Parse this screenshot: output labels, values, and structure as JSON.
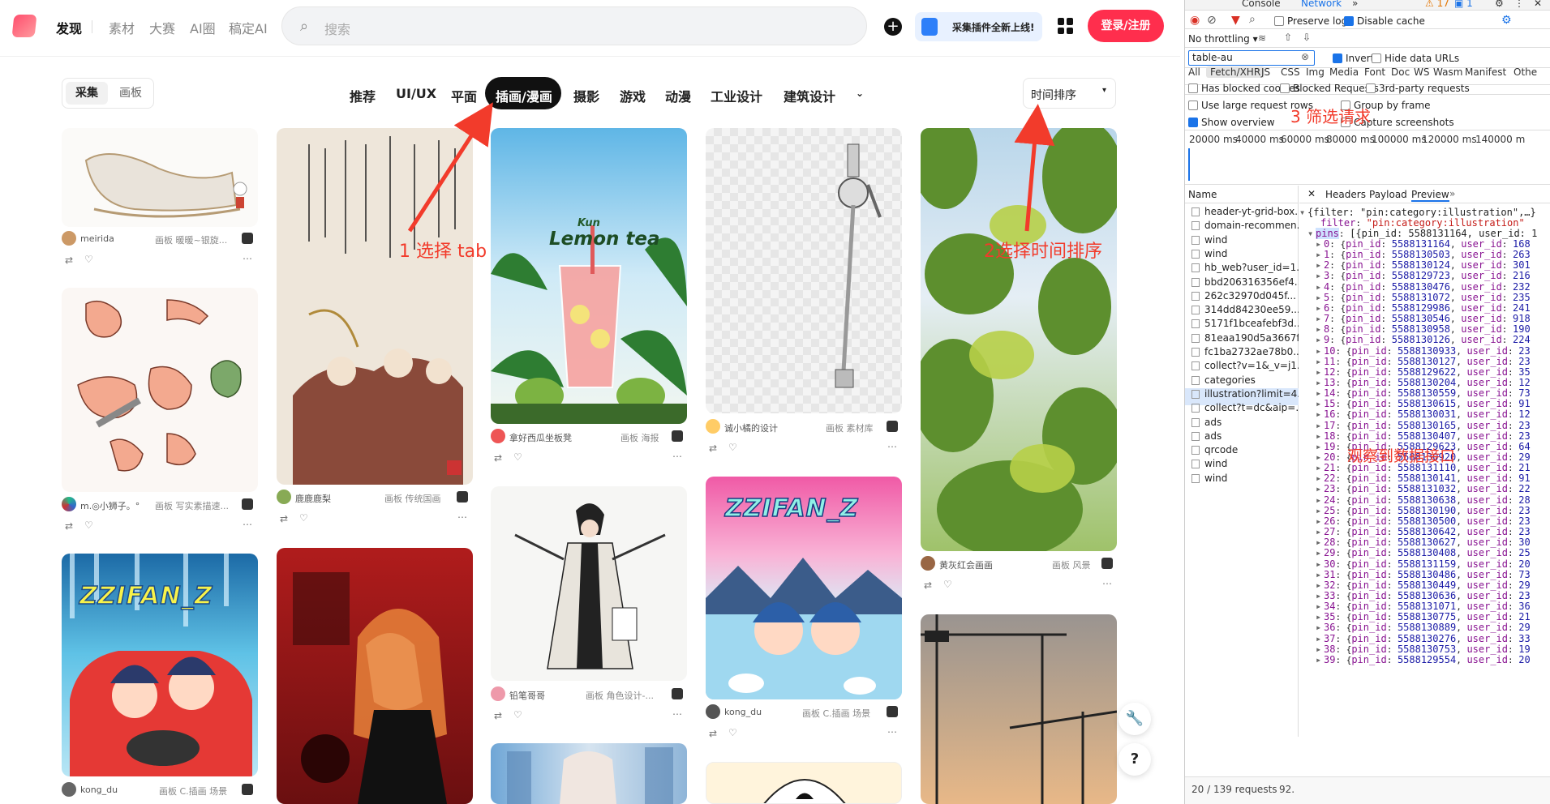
{
  "site": {
    "nav": {
      "discover": "发现",
      "material": "素材",
      "contest": "大赛",
      "ai_circle": "AI圈",
      "gaoding_ai": "稿定AI"
    },
    "search": {
      "placeholder": "搜索"
    },
    "plugin_label": "采集插件全新上线!",
    "login_label": "登录/注册",
    "mode_toggle": {
      "collect": "采集",
      "board": "画板"
    },
    "categories": [
      "推荐",
      "UI/UX",
      "平面",
      "插画/漫画",
      "摄影",
      "游戏",
      "动漫",
      "工业设计",
      "建筑设计"
    ],
    "active_category": "插画/漫画",
    "sort_label": "时间排序",
    "cards": [
      {
        "user": "meirida",
        "board": "画板 暖暖~银旋...",
        "caption_color": "#f5f0ea"
      },
      {
        "user": "m.◎小狮子。°",
        "board": "画板 写实素描速...",
        "caption_color": "#ffffff"
      },
      {
        "user": "kong_du",
        "board": "画板 C.插画 场景",
        "caption_color": "#5ab0e0"
      },
      {
        "user": "鹿鹿鹿梨",
        "board": "画板 传统国画",
        "caption_color": "#efe8dd"
      },
      {
        "user": "",
        "board": "",
        "caption_color": "#7a1a1a"
      },
      {
        "user": "拿好西瓜坐板凳",
        "board": "画板 海报",
        "caption_color": "#cde6f4"
      },
      {
        "user": "铅笔哥哥",
        "board": "画板 角色设计-...",
        "caption_color": "#f2f2f2"
      },
      {
        "user": "诚小橘的设计",
        "board": "画板 素材库",
        "caption_color": "#e8e8e8"
      },
      {
        "user": "kong_du",
        "board": "画板 C.插画 场景",
        "caption_color": "#f29ac6"
      },
      {
        "user": "黄灰红会画画",
        "board": "画板 风景",
        "caption_color": "#5ea0d8"
      }
    ],
    "card_texts": {
      "lemon_brand": "Kun",
      "lemon_title": "Lemon tea",
      "zzifan": "ZZIFAN_Z"
    },
    "annotations": {
      "a1": "1 选择 tab",
      "a2": "2选择时间排序",
      "a3": "3 筛选请求",
      "a4": "观察到数据接口"
    },
    "float_buttons": {
      "tool": "🔧",
      "help": "?"
    }
  },
  "devtools": {
    "top_tabs": {
      "console": "Console",
      "network": "Network"
    },
    "badges": {
      "warn": "17",
      "msg": "1"
    },
    "toolbar": {
      "preserve_log": "Preserve log",
      "disable_cache": "Disable cache",
      "throttle": "No throttling"
    },
    "filter": {
      "value": "table-au",
      "invert": "Invert",
      "hide_data_urls": "Hide data URLs"
    },
    "type_tabs": [
      "All",
      "Fetch/XHR",
      "JS",
      "CSS",
      "Img",
      "Media",
      "Font",
      "Doc",
      "WS",
      "Wasm",
      "Manifest",
      "Othe"
    ],
    "options": {
      "has_blocked": "Has blocked cookies",
      "blocked_requests": "Blocked Requests",
      "third_party": "3rd-party requests",
      "large_rows": "Use large request rows",
      "group_frame": "Group by frame",
      "show_overview": "Show overview",
      "capture_screens": "Capture screenshots"
    },
    "timeline": [
      "20000 ms",
      "40000 ms",
      "60000 ms",
      "80000 ms",
      "100000 ms",
      "120000 ms",
      "140000 m"
    ],
    "name_header": "Name",
    "requests": [
      "header-yt-grid-box...",
      "domain-recommen...",
      "wind",
      "wind",
      "hb_web?user_id=1...",
      "bbd206316356ef4...",
      "262c32970d045f...",
      "314dd84230ee59...",
      "5171f1bceafebf3d...",
      "81eaa190d5a3667f...",
      "fc1ba2732ae78b0...",
      "collect?v=1&_v=j1...",
      "categories",
      "illustration?limit=4...",
      "collect?t=dc&aip=...",
      "ads",
      "ads",
      "qrcode",
      "wind",
      "wind"
    ],
    "selected_request_index": 13,
    "detail_tabs": {
      "headers": "Headers",
      "payload": "Payload",
      "preview": "Preview"
    },
    "preview": {
      "root": "{filter: \"pin:category:illustration\",…}",
      "filter_key": "filter",
      "filter_val": "\"pin:category:illustration\"",
      "pins_key": "pins",
      "pins_summary": "[{pin_id: 5588131164, user_id: 1",
      "items": [
        [
          "0",
          "5588131164",
          "168"
        ],
        [
          "1",
          "5588130503",
          "263"
        ],
        [
          "2",
          "5588130124",
          "301"
        ],
        [
          "3",
          "5588129723",
          "216"
        ],
        [
          "4",
          "5588130476",
          "232"
        ],
        [
          "5",
          "5588131072",
          "235"
        ],
        [
          "6",
          "5588129986",
          "241"
        ],
        [
          "7",
          "5588130546",
          "918"
        ],
        [
          "8",
          "5588130958",
          "190"
        ],
        [
          "9",
          "5588130126",
          "224"
        ],
        [
          "10",
          "5588130933",
          "23"
        ],
        [
          "11",
          "5588130127",
          "23"
        ],
        [
          "12",
          "5588129622",
          "35"
        ],
        [
          "13",
          "5588130204",
          "12"
        ],
        [
          "14",
          "5588130559",
          "73"
        ],
        [
          "15",
          "5588130615",
          "91"
        ],
        [
          "16",
          "5588130031",
          "12"
        ],
        [
          "17",
          "5588130165",
          "23"
        ],
        [
          "18",
          "5588130407",
          "23"
        ],
        [
          "19",
          "5588129623",
          "64"
        ],
        [
          "20",
          "5588130920",
          "29"
        ],
        [
          "21",
          "5588131110",
          "21"
        ],
        [
          "22",
          "5588130141",
          "91"
        ],
        [
          "23",
          "5588131032",
          "22"
        ],
        [
          "24",
          "5588130638",
          "28"
        ],
        [
          "25",
          "5588130190",
          "23"
        ],
        [
          "26",
          "5588130500",
          "23"
        ],
        [
          "27",
          "5588130642",
          "23"
        ],
        [
          "28",
          "5588130627",
          "30"
        ],
        [
          "29",
          "5588130408",
          "25"
        ],
        [
          "30",
          "5588131159",
          "20"
        ],
        [
          "31",
          "5588130486",
          "73"
        ],
        [
          "32",
          "5588130449",
          "29"
        ],
        [
          "33",
          "5588130636",
          "23"
        ],
        [
          "34",
          "5588131071",
          "36"
        ],
        [
          "35",
          "5588130775",
          "21"
        ],
        [
          "36",
          "5588130889",
          "29"
        ],
        [
          "37",
          "5588130276",
          "33"
        ],
        [
          "38",
          "5588130753",
          "19"
        ],
        [
          "39",
          "5588129554",
          "20"
        ]
      ]
    },
    "status": {
      "requests": "20 / 139 requests",
      "size": "92."
    }
  },
  "colors": {
    "brand_red": "#ff2e4d",
    "annotation_red": "#f23b2b",
    "devtools_blue": "#1a73e8"
  }
}
